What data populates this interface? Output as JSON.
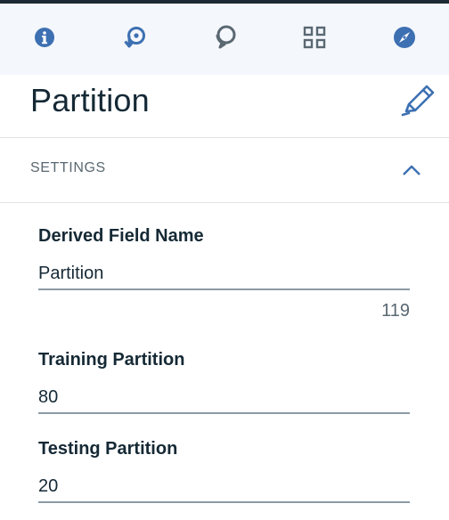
{
  "colors": {
    "accent": "#3d70b2",
    "toolbar_bg": "#f4f7fb",
    "text_primary": "#152935",
    "text_secondary": "#5a6872",
    "divider": "#dfe3e6",
    "input_border": "#8c9ba5"
  },
  "toolbar": {
    "icons": [
      "info-icon",
      "reset-icon",
      "chat-icon",
      "grid-icon",
      "compass-icon"
    ]
  },
  "panel": {
    "title": "Partition",
    "edit_icon": "pencil-icon"
  },
  "settings": {
    "header": "SETTINGS",
    "collapse_icon": "chevron-up-icon",
    "derived_field": {
      "label": "Derived Field Name",
      "value": "Partition",
      "char_count": "119"
    },
    "training": {
      "label": "Training Partition",
      "value": "80"
    },
    "testing": {
      "label": "Testing Partition",
      "value": "20"
    }
  }
}
